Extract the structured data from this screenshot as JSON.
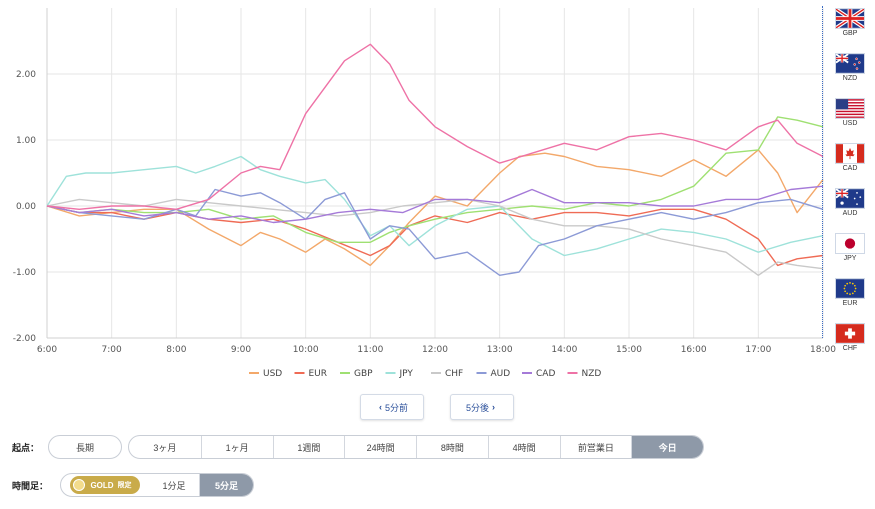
{
  "chart_data": {
    "type": "line",
    "x_ticks": [
      "6:00",
      "7:00",
      "8:00",
      "9:00",
      "10:00",
      "11:00",
      "12:00",
      "13:00",
      "14:00",
      "15:00",
      "16:00",
      "17:00",
      "18:00"
    ],
    "y_ticks": [
      "2.00",
      "1.00",
      "0.00",
      "-1.00",
      "-2.00"
    ],
    "ylim": [
      -2.0,
      3.0
    ],
    "xlim": [
      6.0,
      18.0
    ],
    "grid": true,
    "legend_position": "bottom",
    "series": [
      {
        "name": "USD",
        "color": "#f3a86a",
        "points": [
          [
            6.0,
            0.0
          ],
          [
            6.5,
            -0.15
          ],
          [
            7.0,
            -0.1
          ],
          [
            7.5,
            -0.05
          ],
          [
            8.0,
            -0.05
          ],
          [
            8.5,
            -0.35
          ],
          [
            9.0,
            -0.6
          ],
          [
            9.3,
            -0.4
          ],
          [
            9.6,
            -0.5
          ],
          [
            10.0,
            -0.7
          ],
          [
            10.3,
            -0.5
          ],
          [
            10.6,
            -0.65
          ],
          [
            11.0,
            -0.9
          ],
          [
            11.3,
            -0.6
          ],
          [
            11.6,
            -0.25
          ],
          [
            12.0,
            0.15
          ],
          [
            12.5,
            0.0
          ],
          [
            13.0,
            0.5
          ],
          [
            13.3,
            0.75
          ],
          [
            13.7,
            0.8
          ],
          [
            14.0,
            0.75
          ],
          [
            14.5,
            0.6
          ],
          [
            15.0,
            0.55
          ],
          [
            15.5,
            0.45
          ],
          [
            16.0,
            0.7
          ],
          [
            16.5,
            0.45
          ],
          [
            17.0,
            0.85
          ],
          [
            17.3,
            0.5
          ],
          [
            17.6,
            -0.1
          ],
          [
            18.0,
            0.4
          ]
        ]
      },
      {
        "name": "EUR",
        "color": "#ef6b55",
        "points": [
          [
            6.0,
            0.0
          ],
          [
            6.5,
            -0.1
          ],
          [
            7.0,
            -0.1
          ],
          [
            7.5,
            -0.2
          ],
          [
            8.0,
            -0.1
          ],
          [
            8.5,
            -0.2
          ],
          [
            9.0,
            -0.25
          ],
          [
            9.5,
            -0.2
          ],
          [
            10.0,
            -0.35
          ],
          [
            10.5,
            -0.55
          ],
          [
            11.0,
            -0.75
          ],
          [
            11.3,
            -0.6
          ],
          [
            11.6,
            -0.3
          ],
          [
            12.0,
            -0.15
          ],
          [
            12.5,
            -0.25
          ],
          [
            13.0,
            -0.1
          ],
          [
            13.5,
            -0.2
          ],
          [
            14.0,
            -0.1
          ],
          [
            14.5,
            -0.1
          ],
          [
            15.0,
            -0.15
          ],
          [
            15.5,
            -0.05
          ],
          [
            16.0,
            -0.05
          ],
          [
            16.5,
            -0.2
          ],
          [
            17.0,
            -0.5
          ],
          [
            17.3,
            -0.9
          ],
          [
            17.6,
            -0.8
          ],
          [
            18.0,
            -0.75
          ]
        ]
      },
      {
        "name": "GBP",
        "color": "#9fe072",
        "points": [
          [
            6.0,
            0.0
          ],
          [
            6.5,
            -0.1
          ],
          [
            7.0,
            -0.05
          ],
          [
            7.5,
            -0.1
          ],
          [
            8.0,
            -0.1
          ],
          [
            8.5,
            -0.05
          ],
          [
            9.0,
            -0.2
          ],
          [
            9.5,
            -0.15
          ],
          [
            10.0,
            -0.4
          ],
          [
            10.5,
            -0.55
          ],
          [
            11.0,
            -0.55
          ],
          [
            11.3,
            -0.4
          ],
          [
            11.6,
            -0.3
          ],
          [
            12.0,
            -0.2
          ],
          [
            12.5,
            -0.1
          ],
          [
            13.0,
            -0.05
          ],
          [
            13.5,
            0.0
          ],
          [
            14.0,
            -0.05
          ],
          [
            14.5,
            0.05
          ],
          [
            15.0,
            0.0
          ],
          [
            15.5,
            0.1
          ],
          [
            16.0,
            0.3
          ],
          [
            16.5,
            0.8
          ],
          [
            17.0,
            0.85
          ],
          [
            17.3,
            1.35
          ],
          [
            17.6,
            1.3
          ],
          [
            18.0,
            1.2
          ]
        ]
      },
      {
        "name": "JPY",
        "color": "#9ee2da",
        "points": [
          [
            6.0,
            0.0
          ],
          [
            6.3,
            0.45
          ],
          [
            6.6,
            0.5
          ],
          [
            7.0,
            0.5
          ],
          [
            7.5,
            0.55
          ],
          [
            8.0,
            0.6
          ],
          [
            8.3,
            0.5
          ],
          [
            8.6,
            0.6
          ],
          [
            9.0,
            0.75
          ],
          [
            9.3,
            0.55
          ],
          [
            9.6,
            0.45
          ],
          [
            10.0,
            0.35
          ],
          [
            10.3,
            0.4
          ],
          [
            10.6,
            0.1
          ],
          [
            11.0,
            -0.45
          ],
          [
            11.3,
            -0.3
          ],
          [
            11.6,
            -0.6
          ],
          [
            12.0,
            -0.3
          ],
          [
            12.5,
            -0.05
          ],
          [
            13.0,
            0.0
          ],
          [
            13.5,
            -0.5
          ],
          [
            14.0,
            -0.75
          ],
          [
            14.5,
            -0.65
          ],
          [
            15.0,
            -0.5
          ],
          [
            15.5,
            -0.35
          ],
          [
            16.0,
            -0.4
          ],
          [
            16.5,
            -0.5
          ],
          [
            17.0,
            -0.7
          ],
          [
            17.5,
            -0.55
          ],
          [
            18.0,
            -0.45
          ]
        ]
      },
      {
        "name": "CHF",
        "color": "#c9c9c9",
        "points": [
          [
            6.0,
            0.0
          ],
          [
            6.5,
            0.1
          ],
          [
            7.0,
            0.05
          ],
          [
            7.5,
            0.0
          ],
          [
            8.0,
            0.1
          ],
          [
            8.5,
            0.05
          ],
          [
            9.0,
            0.0
          ],
          [
            9.5,
            -0.05
          ],
          [
            10.0,
            -0.1
          ],
          [
            10.5,
            -0.15
          ],
          [
            11.0,
            -0.1
          ],
          [
            11.5,
            0.0
          ],
          [
            12.0,
            0.05
          ],
          [
            12.5,
            0.1
          ],
          [
            13.0,
            0.0
          ],
          [
            13.5,
            -0.2
          ],
          [
            14.0,
            -0.3
          ],
          [
            14.5,
            -0.3
          ],
          [
            15.0,
            -0.35
          ],
          [
            15.5,
            -0.5
          ],
          [
            16.0,
            -0.6
          ],
          [
            16.5,
            -0.7
          ],
          [
            17.0,
            -1.05
          ],
          [
            17.3,
            -0.85
          ],
          [
            17.6,
            -0.9
          ],
          [
            18.0,
            -0.95
          ]
        ]
      },
      {
        "name": "AUD",
        "color": "#8c9ad6",
        "points": [
          [
            6.0,
            0.0
          ],
          [
            6.5,
            -0.1
          ],
          [
            7.0,
            -0.15
          ],
          [
            7.5,
            -0.2
          ],
          [
            8.0,
            -0.05
          ],
          [
            8.3,
            -0.15
          ],
          [
            8.6,
            0.25
          ],
          [
            9.0,
            0.15
          ],
          [
            9.3,
            0.2
          ],
          [
            9.6,
            0.05
          ],
          [
            10.0,
            -0.2
          ],
          [
            10.3,
            0.1
          ],
          [
            10.6,
            0.2
          ],
          [
            11.0,
            -0.5
          ],
          [
            11.3,
            -0.3
          ],
          [
            11.6,
            -0.35
          ],
          [
            12.0,
            -0.8
          ],
          [
            12.5,
            -0.7
          ],
          [
            13.0,
            -1.05
          ],
          [
            13.3,
            -1.0
          ],
          [
            13.6,
            -0.6
          ],
          [
            14.0,
            -0.5
          ],
          [
            14.5,
            -0.3
          ],
          [
            15.0,
            -0.2
          ],
          [
            15.5,
            -0.1
          ],
          [
            16.0,
            -0.2
          ],
          [
            16.5,
            -0.1
          ],
          [
            17.0,
            0.05
          ],
          [
            17.5,
            0.1
          ],
          [
            18.0,
            -0.05
          ]
        ]
      },
      {
        "name": "CAD",
        "color": "#a57ad8",
        "points": [
          [
            6.0,
            0.0
          ],
          [
            6.5,
            -0.1
          ],
          [
            7.0,
            -0.05
          ],
          [
            7.5,
            -0.15
          ],
          [
            8.0,
            -0.1
          ],
          [
            8.5,
            -0.2
          ],
          [
            9.0,
            -0.15
          ],
          [
            9.5,
            -0.25
          ],
          [
            10.0,
            -0.2
          ],
          [
            10.5,
            -0.1
          ],
          [
            11.0,
            -0.05
          ],
          [
            11.5,
            -0.1
          ],
          [
            12.0,
            0.1
          ],
          [
            12.5,
            0.1
          ],
          [
            13.0,
            0.05
          ],
          [
            13.5,
            0.25
          ],
          [
            14.0,
            0.05
          ],
          [
            14.5,
            0.05
          ],
          [
            15.0,
            0.05
          ],
          [
            15.5,
            0.0
          ],
          [
            16.0,
            0.0
          ],
          [
            16.5,
            0.1
          ],
          [
            17.0,
            0.1
          ],
          [
            17.5,
            0.25
          ],
          [
            18.0,
            0.3
          ]
        ]
      },
      {
        "name": "NZD",
        "color": "#ee72a6",
        "points": [
          [
            6.0,
            0.0
          ],
          [
            6.5,
            -0.05
          ],
          [
            7.0,
            0.0
          ],
          [
            7.5,
            0.0
          ],
          [
            8.0,
            -0.05
          ],
          [
            8.5,
            0.1
          ],
          [
            9.0,
            0.5
          ],
          [
            9.3,
            0.6
          ],
          [
            9.6,
            0.55
          ],
          [
            10.0,
            1.4
          ],
          [
            10.3,
            1.8
          ],
          [
            10.6,
            2.2
          ],
          [
            11.0,
            2.45
          ],
          [
            11.3,
            2.15
          ],
          [
            11.6,
            1.6
          ],
          [
            12.0,
            1.2
          ],
          [
            12.5,
            0.9
          ],
          [
            13.0,
            0.65
          ],
          [
            13.5,
            0.8
          ],
          [
            14.0,
            0.95
          ],
          [
            14.5,
            0.85
          ],
          [
            15.0,
            1.05
          ],
          [
            15.5,
            1.1
          ],
          [
            16.0,
            1.0
          ],
          [
            16.5,
            0.85
          ],
          [
            17.0,
            1.2
          ],
          [
            17.3,
            1.3
          ],
          [
            17.6,
            0.95
          ],
          [
            18.0,
            0.75
          ]
        ]
      }
    ]
  },
  "flags": [
    {
      "code": "GBP",
      "icon": "uk-flag-icon"
    },
    {
      "code": "NZD",
      "icon": "nz-flag-icon"
    },
    {
      "code": "USD",
      "icon": "us-flag-icon"
    },
    {
      "code": "CAD",
      "icon": "canada-flag-icon"
    },
    {
      "code": "AUD",
      "icon": "australia-flag-icon"
    },
    {
      "code": "JPY",
      "icon": "japan-flag-icon"
    },
    {
      "code": "EUR",
      "icon": "eu-flag-icon"
    },
    {
      "code": "CHF",
      "icon": "swiss-flag-icon"
    }
  ],
  "nav": {
    "prev_label": "5分前",
    "next_label": "5分後"
  },
  "origin": {
    "label": "起点：",
    "long_term": "長期",
    "options": [
      "3ヶ月",
      "1ヶ月",
      "1週間",
      "24時間",
      "8時間",
      "4時間",
      "前営業日",
      "今日"
    ],
    "active": "今日"
  },
  "timeframe": {
    "label": "時間足：",
    "gold_text": "GOLD",
    "gold_tag": "限定",
    "options": [
      "1分足",
      "5分足"
    ],
    "active": "5分足"
  }
}
